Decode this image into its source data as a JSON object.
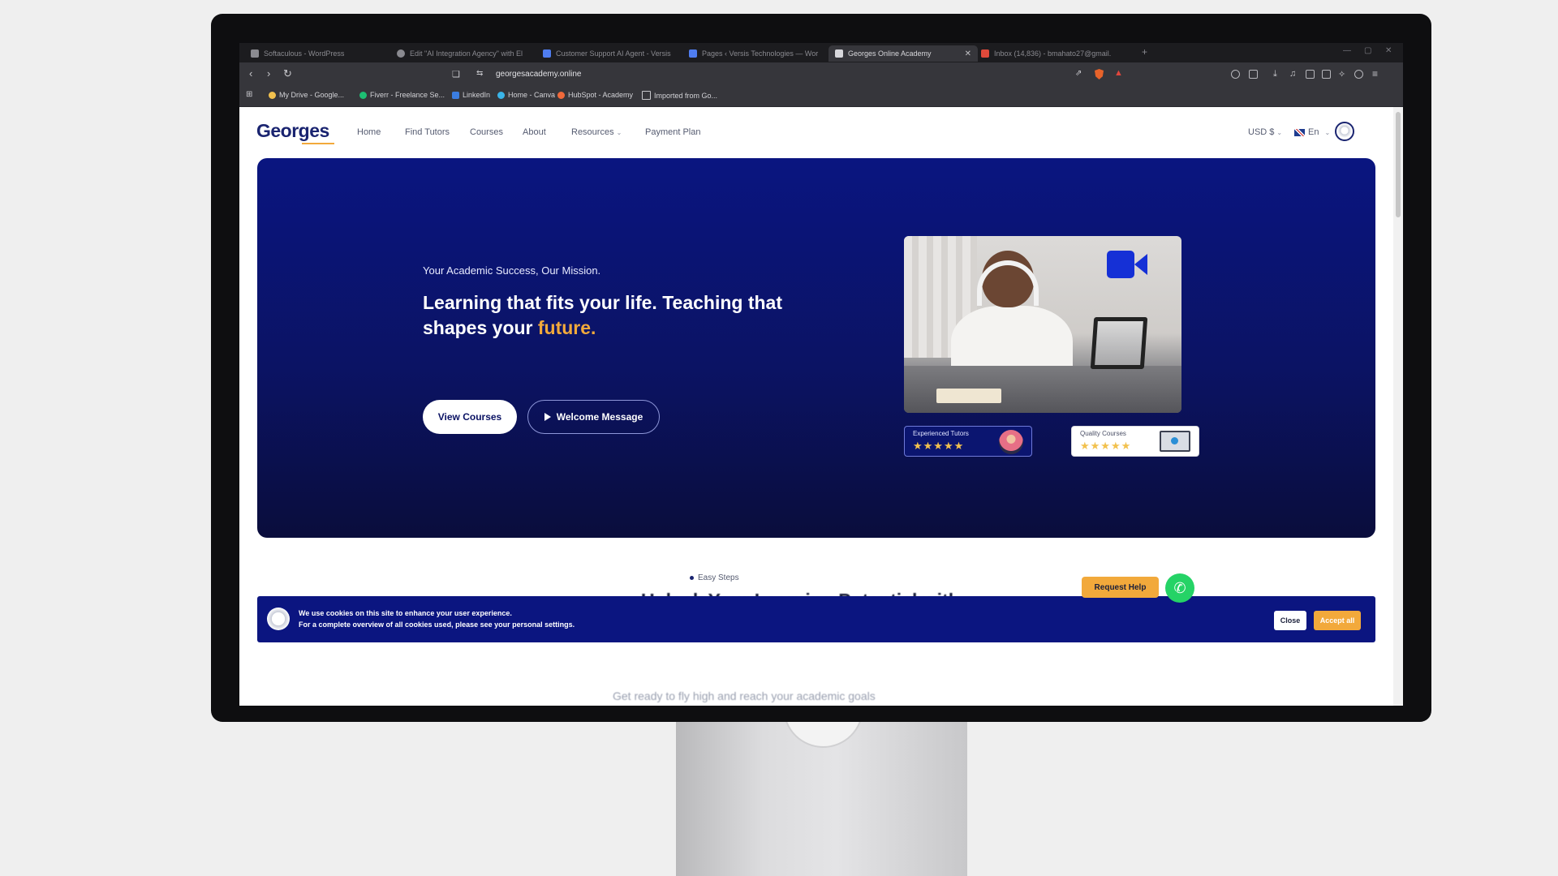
{
  "browser": {
    "tabs": [
      {
        "title": "Softaculous - WordPress",
        "favicon_color": "#8a8a90"
      },
      {
        "title": "Edit \"AI Integration Agency\" with El",
        "favicon_color": "#8a8a90"
      },
      {
        "title": "Customer Support AI Agent - Versis",
        "favicon_color": "#4f7df0"
      },
      {
        "title": "Pages ‹ Versis Technologies — Wor",
        "favicon_color": "#4f7df0"
      },
      {
        "title": "Georges Online Academy",
        "favicon_color": "#d8d8dc"
      },
      {
        "title": "Inbox (14,836) - bmahato27@gmail.",
        "favicon_color": "#e04a3b"
      }
    ],
    "url": "georgesacademy.online",
    "bookmarks": [
      {
        "label": "My Drive - Google...",
        "color": "#f2c14e"
      },
      {
        "label": "Fiverr - Freelance Se...",
        "color": "#1dbf73"
      },
      {
        "label": "LinkedIn",
        "color": "#3b7de0"
      },
      {
        "label": "Home - Canva",
        "color": "#3ab4e8"
      },
      {
        "label": "HubSpot - Academy",
        "color": "#f0693a"
      },
      {
        "label": "Imported from Go...",
        "color": "#c8c8cc"
      }
    ]
  },
  "site": {
    "logo": "Georges",
    "nav": [
      "Home",
      "Find Tutors",
      "Courses",
      "About",
      "Resources",
      "Payment Plan"
    ],
    "currency": "USD $",
    "language": "En"
  },
  "hero": {
    "subtitle": "Your Academic Success, Our Mission.",
    "title_part1": "Learning that fits your life. Teaching that shapes your ",
    "title_accent": "future.",
    "btn_courses": "View Courses",
    "btn_welcome": "Welcome Message",
    "card_tutors": "Experienced Tutors",
    "card_courses": "Quality Courses",
    "stars": "★★★★★",
    "colors": {
      "accent": "#f2a93b",
      "primary": "#0b1364"
    }
  },
  "steps": {
    "eyebrow": "Easy Steps",
    "title": "Unlock Your Learning Potential with",
    "subtitle": "Get ready to fly high and reach your academic goals"
  },
  "help": {
    "request_help": "Request Help"
  },
  "cookie": {
    "line1": "We use cookies on this site to enhance your user experience.",
    "line2": "For a complete overview of all cookies used, please see your personal settings.",
    "close": "Close",
    "accept": "Accept all"
  }
}
